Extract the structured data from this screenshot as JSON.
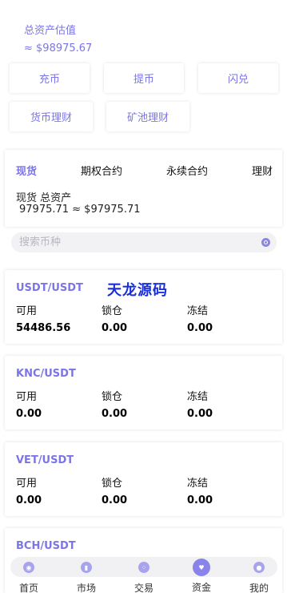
{
  "header": {
    "label": "总资产估值",
    "value": "≈ $98975.67"
  },
  "actions": [
    "充币",
    "提币",
    "闪兑",
    "货币理财",
    "矿池理财"
  ],
  "account": {
    "tabs": [
      {
        "label": "现货",
        "active": true
      },
      {
        "label": "期权合约",
        "active": false
      },
      {
        "label": "永续合约",
        "active": false
      },
      {
        "label": "理财",
        "active": false
      }
    ],
    "assets_label": "现货 总资产",
    "assets_value": "97975.71 ≈ $97975.71"
  },
  "search": {
    "placeholder": "搜索币种"
  },
  "watermark": "天龙源码",
  "asset_columns": [
    "可用",
    "锁仓",
    "冻结"
  ],
  "assets": [
    {
      "pair": "USDT/USDT",
      "available": "54486.56",
      "locked": "0.00",
      "frozen": "0.00"
    },
    {
      "pair": "KNC/USDT",
      "available": "0.00",
      "locked": "0.00",
      "frozen": "0.00"
    },
    {
      "pair": "VET/USDT",
      "available": "0.00",
      "locked": "0.00",
      "frozen": "0.00"
    },
    {
      "pair": "BCH/USDT"
    }
  ],
  "nav": [
    {
      "label": "首页",
      "icon": "home-icon"
    },
    {
      "label": "市场",
      "icon": "market-icon"
    },
    {
      "label": "交易",
      "icon": "trade-icon"
    },
    {
      "label": "资金",
      "icon": "funds-icon",
      "active": true
    },
    {
      "label": "我的",
      "icon": "profile-icon"
    }
  ],
  "colors": {
    "accent": "#7b75e6",
    "watermark": "#1b2fd8"
  }
}
